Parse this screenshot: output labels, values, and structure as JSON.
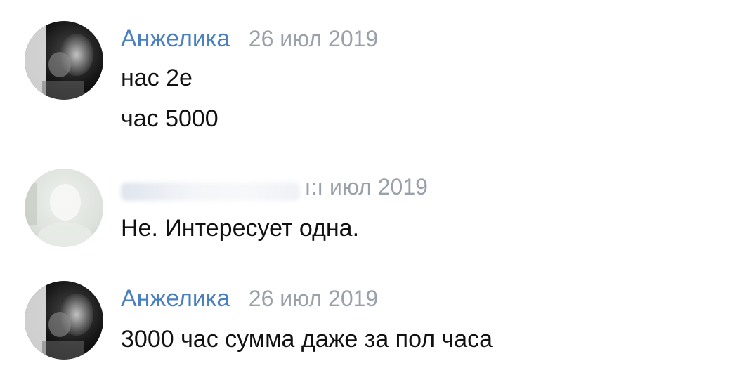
{
  "messages": [
    {
      "author": "Анжелика",
      "date": "26 июл 2019",
      "lines": [
        "нас 2е",
        "час 5000"
      ]
    },
    {
      "author": "",
      "date": "ı:ı июл 2019",
      "lines": [
        "Не. Интересует одна."
      ]
    },
    {
      "author": "Анжелика",
      "date": "26 июл 2019",
      "lines": [
        "3000 час сумма даже за пол часа"
      ]
    }
  ],
  "colors": {
    "author": "#4a7fc0",
    "date": "#9aa1ab",
    "text": "#111111",
    "background": "#ffffff"
  }
}
